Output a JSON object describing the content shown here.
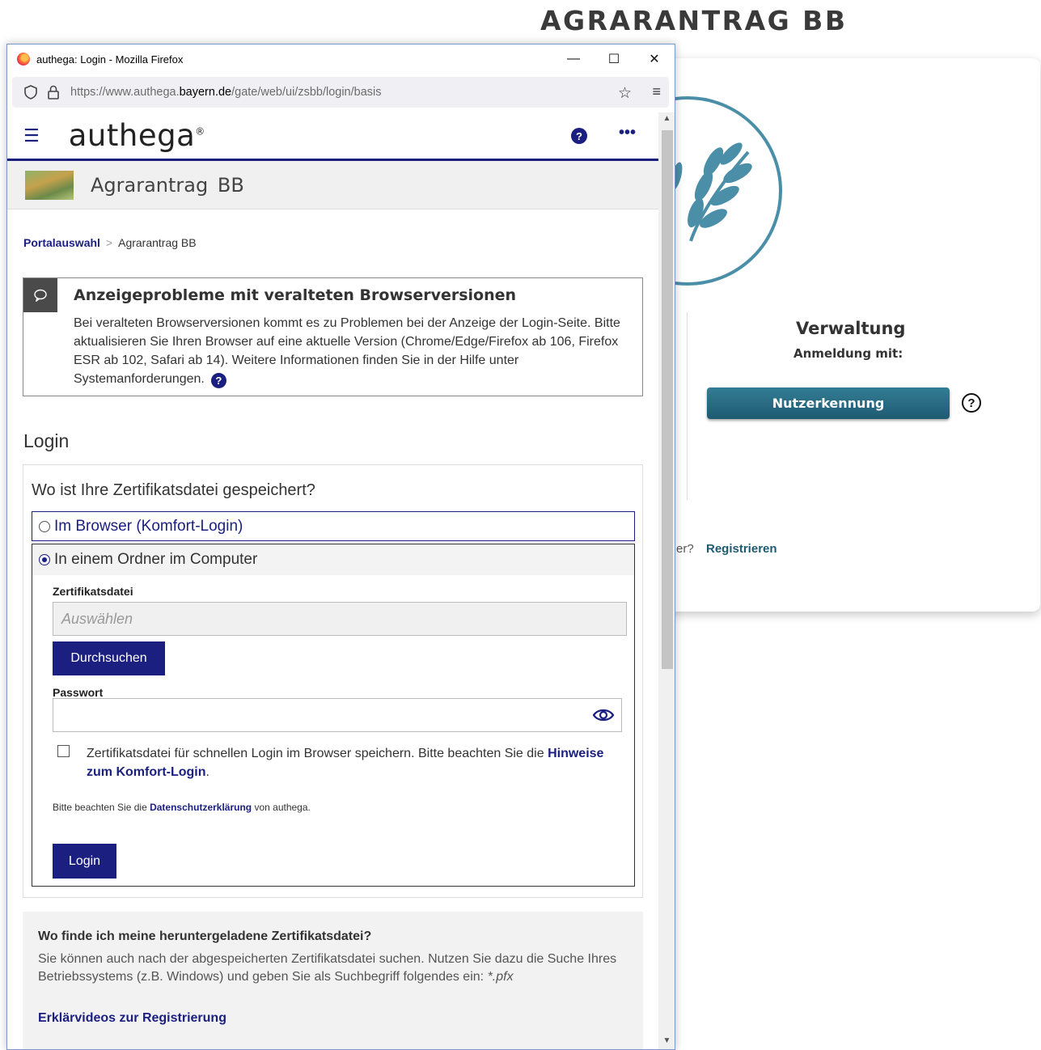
{
  "page": {
    "heading": "AGRARANTRAG BB"
  },
  "background_portal": {
    "admin_title": "Verwaltung",
    "admin_subtitle": "Anmeldung mit:",
    "nutzer_button": "Nutzerkennung",
    "help_icon": "question-circle-icon",
    "register_prefix": "er?",
    "register_link": "Registrieren",
    "accent_color": "#1e5a72"
  },
  "browser": {
    "window_title": "authega: Login - Mozilla Firefox",
    "url_prefix": "https://www.authega.",
    "url_domain": "bayern.de",
    "url_suffix": "/gate/web/ui/zsbb/login/basis",
    "minimize": "—",
    "maximize": "☐",
    "close": "✕"
  },
  "authega": {
    "logo": "authega",
    "logo_mark": "®",
    "help_glyph": "?",
    "more_glyph": "•••",
    "app_title": "Agrarantrag BB",
    "breadcrumb": {
      "root": "Portalauswahl",
      "separator": ">",
      "current": "Agrarantrag BB"
    },
    "notice": {
      "title": "Anzeigeprobleme mit veralteten Browserversionen",
      "text": "Bei veralteten Browserversionen kommt es zu Problemen bei der Anzeige der Login-Seite. Bitte aktualisieren Sie Ihren Browser auf eine aktuelle Version (Chrome/Edge/Firefox ab 106, Firefox ESR ab 102, Safari ab 14). Weitere Informationen finden Sie in der Hilfe unter Systemanforderungen."
    },
    "login": {
      "heading": "Login",
      "question": "Wo ist Ihre Zertifikatsdatei gespeichert?",
      "option_browser": "Im Browser (Komfort-Login)",
      "option_folder": "In einem Ordner im Computer",
      "selected_option": "In einem Ordner im Computer",
      "file_label": "Zertifikatsdatei",
      "file_placeholder": "Auswählen",
      "browse_button": "Durchsuchen",
      "password_label": "Passwort",
      "password_value": "",
      "save_checkbox_text": "Zertifikatsdatei für schnellen Login im Browser speichern. Bitte beachten Sie die",
      "save_checkbox_link": "Hinweise zum Komfort-Login",
      "save_checkbox_end": ".",
      "privacy_prefix": "Bitte beachten Sie die",
      "privacy_link": "Datenschutzerklärung",
      "privacy_suffix": "von authega.",
      "login_button": "Login"
    },
    "help": {
      "title": "Wo finde ich meine heruntergeladene Zertifikatsdatei?",
      "text": "Sie können auch nach der abgespeicherten Zertifikatsdatei suchen. Nutzen Sie dazu die Suche Ihres Betriebssystems (z.B. Windows) und geben Sie als Suchbegriff folgendes ein:",
      "search_term": "*.pfx",
      "video_link": "Erklärvideos zur Registrierung"
    },
    "brand_color": "#1a1f80"
  }
}
